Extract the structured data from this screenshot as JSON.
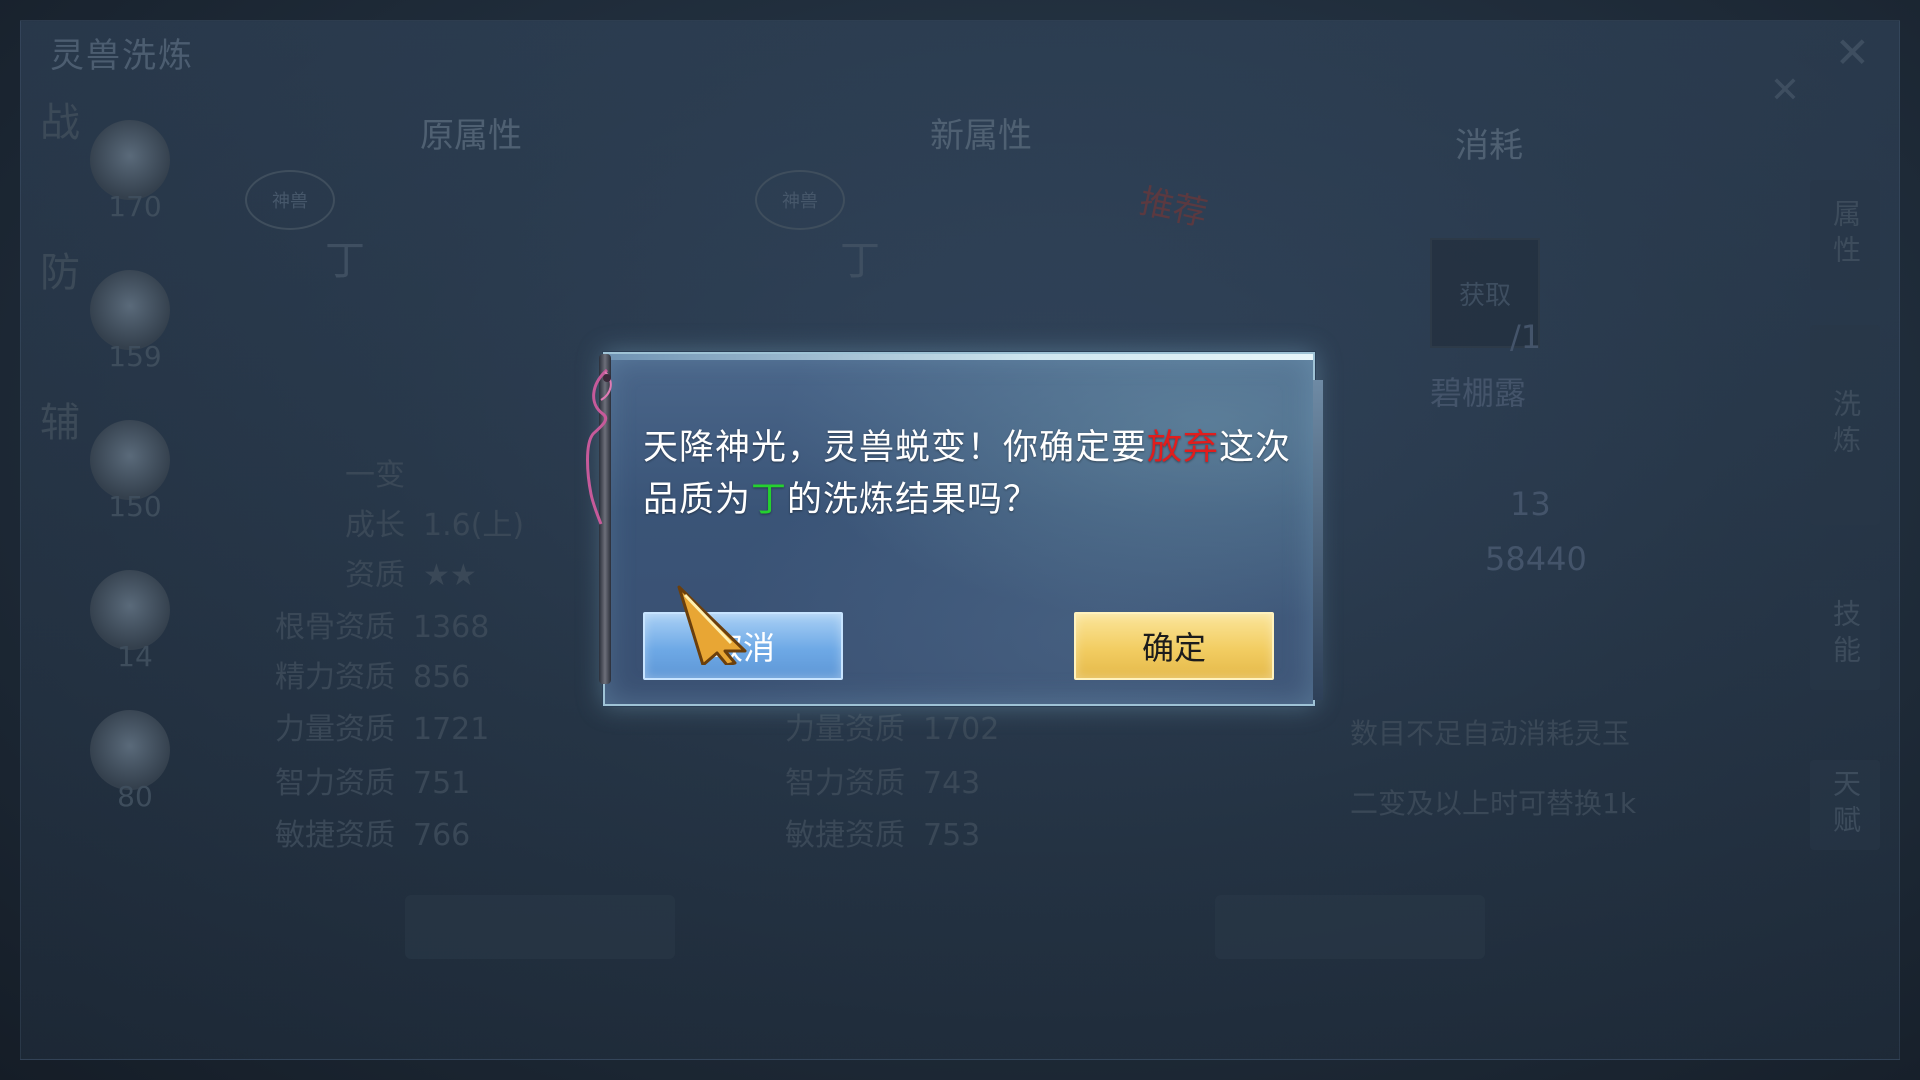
{
  "background": {
    "panel_title": "灵兽洗炼",
    "close_glyph": "✕",
    "rail": [
      {
        "tag": "战",
        "level": "170"
      },
      {
        "tag": "防",
        "level": "159"
      },
      {
        "tag": "辅",
        "level": "150"
      },
      {
        "tag": "",
        "level": "14"
      },
      {
        "tag": "",
        "level": "80"
      }
    ],
    "columns": {
      "original": "原属性",
      "new": "新属性",
      "consume": "消耗"
    },
    "badge_label": "神兽",
    "grade": "丁",
    "recommend": "推荐",
    "original_stats": [
      {
        "label": "一变",
        "value": ""
      },
      {
        "label": "成长",
        "value": "1.6(上)"
      },
      {
        "label": "资质",
        "value": "★★"
      },
      {
        "label": "根骨资质",
        "value": "1368"
      },
      {
        "label": "精力资质",
        "value": "856"
      },
      {
        "label": "力量资质",
        "value": "1721"
      },
      {
        "label": "智力资质",
        "value": "751"
      },
      {
        "label": "敏捷资质",
        "value": "766"
      }
    ],
    "new_stats": [
      {
        "label": "力量资质",
        "value": "1702"
      },
      {
        "label": "智力资质",
        "value": "743"
      },
      {
        "label": "敏捷资质",
        "value": "753"
      }
    ],
    "consume": {
      "item_label": "获取",
      "count": "/1",
      "item_name": "碧棚露",
      "row1_value": "13",
      "row2_value": "58440"
    },
    "side_tabs": [
      "洗炼",
      "技能",
      "天赋"
    ],
    "side_tab_top": "属性",
    "notes": [
      "数目不足自动消耗灵玉",
      "二变及以上时可替换1k"
    ]
  },
  "dialog": {
    "message_part1": "天降神光，灵兽蜕变！你确定要",
    "message_highlight_abandon": "放弃",
    "message_part2": "这次品质为",
    "message_highlight_grade": "丁",
    "message_part3": "的洗炼结果吗？",
    "cancel_label": "取消",
    "confirm_label": "确定",
    "colors": {
      "abandon": "#e11d1d",
      "grade": "#25d12f",
      "cancel_button": "#7ab2ea",
      "confirm_button": "#f2cd62"
    }
  },
  "cursor_icon": "golden-arrow-cursor"
}
